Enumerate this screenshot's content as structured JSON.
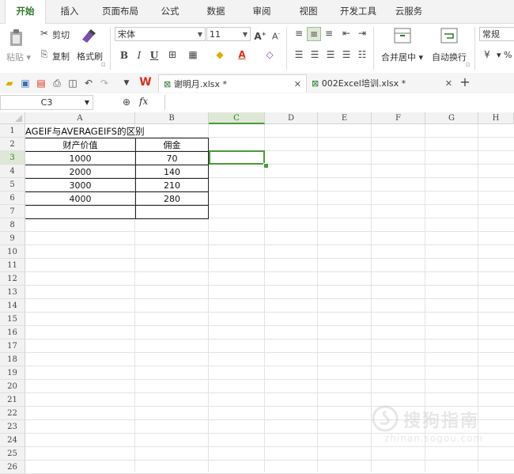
{
  "menu": {
    "tabs": [
      "开始",
      "插入",
      "页面布局",
      "公式",
      "数据",
      "审阅",
      "视图",
      "开发工具",
      "云服务"
    ],
    "active": "开始"
  },
  "ribbon": {
    "paste": "粘贴",
    "cut": "剪切",
    "copy": "复制",
    "format_painter": "格式刷",
    "font_name": "宋体",
    "font_size": "11",
    "merge_center": "合并居中",
    "wrap_text": "自动换行",
    "number_format": "常规",
    "bold": "B",
    "italic": "I",
    "underline": "U",
    "percent": "%"
  },
  "doc_tabs": [
    {
      "name": "谢明月.xlsx *",
      "active": true
    },
    {
      "name": "002Excel培训.xlsx *",
      "active": false
    }
  ],
  "formula": {
    "name_box": "C3",
    "fx_label": "fx",
    "value": ""
  },
  "columns": [
    "A",
    "B",
    "C",
    "D",
    "E",
    "F",
    "G",
    "H"
  ],
  "selected_cell": "C3",
  "rows": [
    "1",
    "2",
    "3",
    "4",
    "5",
    "6",
    "7",
    "8",
    "9",
    "10",
    "11",
    "12",
    "13",
    "14",
    "15",
    "16",
    "17",
    "18",
    "19",
    "20",
    "21",
    "22",
    "23",
    "24",
    "25",
    "26"
  ],
  "sheet": {
    "title": "AGEIF与AVERAGEIFS的区别",
    "header_a": "财产价值",
    "header_b": "佣金",
    "data": [
      {
        "a": "1000",
        "b": "70"
      },
      {
        "a": "2000",
        "b": "140"
      },
      {
        "a": "3000",
        "b": "210"
      },
      {
        "a": "4000",
        "b": "280"
      }
    ]
  },
  "watermark": {
    "text": "搜狗指南",
    "sub": "zhinan.sogou.com"
  },
  "colors": {
    "accent_green": "#2b7a2b",
    "selection_border": "#4a9a3a",
    "header_bg": "#f2f2f2",
    "wps_red": "#d9301e"
  }
}
